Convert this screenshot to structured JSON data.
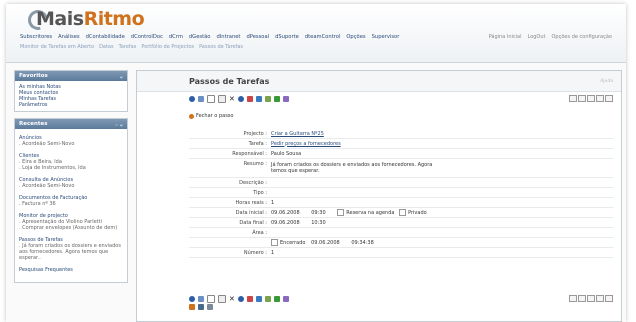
{
  "logo": {
    "prefix": "Mais",
    "suffix": "Ritmo"
  },
  "topnav": [
    "Subscritores",
    "Análises",
    "dContabilidade",
    "dControlDoc",
    "dCrm",
    "dGestão",
    "dIntranet",
    "dPessoal",
    "dSuporte",
    "dteamControl",
    "Opções",
    "Supervisor"
  ],
  "subnav": [
    "Monitor de Tarefas em Aberto",
    "Datas",
    "Tarefas",
    "Portfólio de Projectos",
    "Passos de Tarefas"
  ],
  "toplinks": [
    "Página Inicial",
    "LogOut",
    "Opções de configuração"
  ],
  "favoritos": {
    "title": "Favoritos",
    "items": [
      "As minhas Notas",
      "Meus contactos",
      "Minhas Tarefas",
      "Parâmetros"
    ]
  },
  "recentes": {
    "title": "Recentes",
    "groups": [
      {
        "title": "Anúncios",
        "items": [
          ". Acordeão Semi-Novo"
        ]
      },
      {
        "title": "Clientes",
        "items": [
          ". Eira e Beira, lda",
          ". Loja de Instrumentos, lda"
        ]
      },
      {
        "title": "Consulta de Anúncios",
        "items": [
          ". Acordeão Semi-Novo"
        ]
      },
      {
        "title": "Documentos de Facturação",
        "items": [
          ". Factura nº 36"
        ]
      },
      {
        "title": "Monitor de projecto",
        "items": [
          ". Apresentação do Violino Parletti",
          ". Comprar envelopes (Assunto de dem)"
        ]
      },
      {
        "title": "Passos de Tarefas",
        "items": [
          ". Já foram criados os dossiers e enviados aos fornecedores. Agora temos que esperar.."
        ]
      },
      {
        "title": "Pesquisas Frequentes",
        "items": []
      }
    ]
  },
  "main": {
    "title": "Passos de Tarefas",
    "help": "Ajuda",
    "close_step": "Fechar o passo",
    "fields": {
      "projecto_label": "Projecto :",
      "projecto_value": "Criar a Guitarra Nº25",
      "tarefa_label": "Tarefa :",
      "tarefa_value": "Pedir preços a fornecedores",
      "responsavel_label": "Responsável :",
      "responsavel_value": "Paulo Sousa",
      "resumo_label": "Resumo :",
      "resumo_value": "Já foram criados os dossiers e enviados aos fornecedores. Agora temos que esperar.",
      "descricao_label": "Descrição :",
      "tipo_label": "Tipo :",
      "horas_label": "Horas reais :",
      "horas_value": "1",
      "data_inicial_label": "Data inicial :",
      "data_inicial_value": "09.06.2008",
      "hora_inicial_value": "09:30",
      "reserva_label": "Reserva na agenda",
      "privado_label": "Privado",
      "data_final_label": "Data final :",
      "data_final_value": "09.06.2008",
      "hora_final_value": "10:30",
      "area_label": "Área :",
      "encerrado_label": "Encerrado",
      "encerrado_date": "09.06.2008",
      "encerrado_time": "09:34:38",
      "numero_label": "Número :",
      "numero_value": "1"
    }
  },
  "colors": {
    "brand": "#d0721c",
    "panel_head": "#5b7a9b",
    "link": "#2a4a7a"
  }
}
